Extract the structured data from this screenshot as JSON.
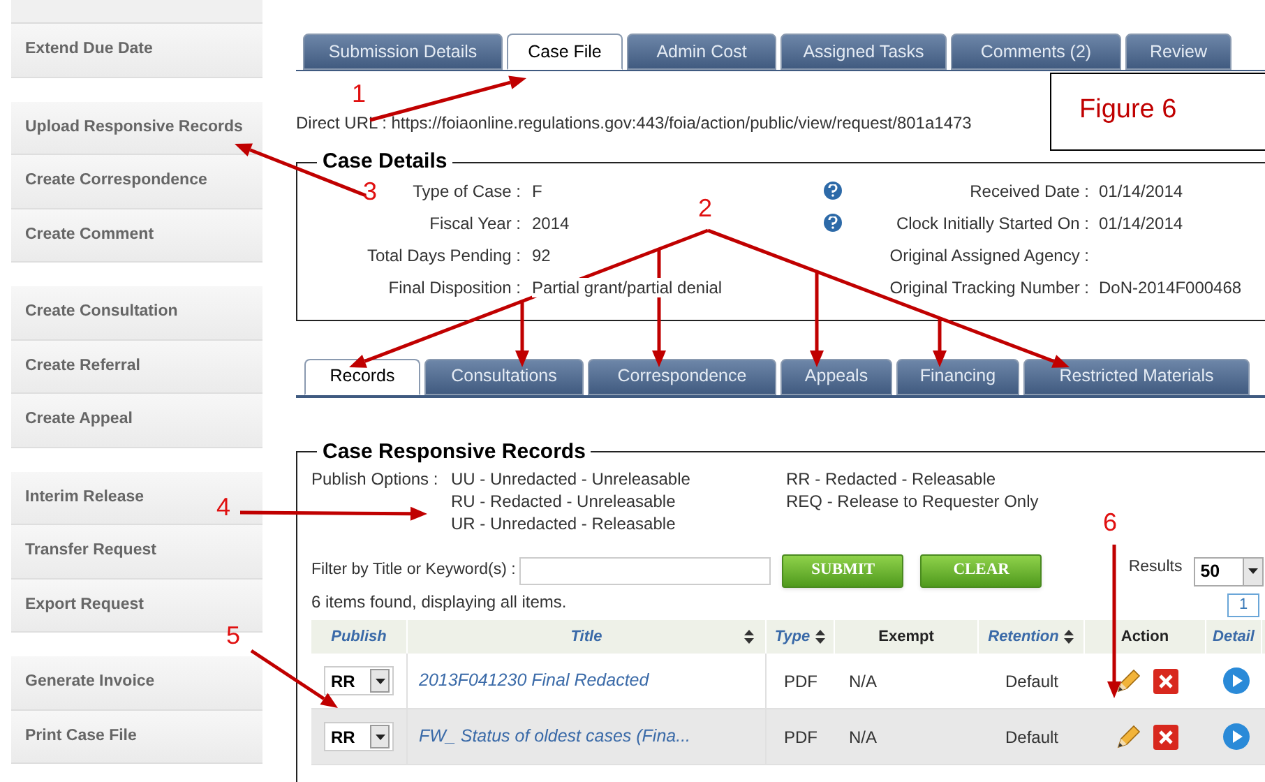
{
  "sidebar": {
    "groups": [
      [
        {
          "label": "Extend Due Date"
        }
      ],
      [
        {
          "label": "Upload Responsive Records"
        },
        {
          "label": "Create Correspondence"
        },
        {
          "label": "Create Comment"
        }
      ],
      [
        {
          "label": "Create Consultation"
        },
        {
          "label": "Create Referral"
        },
        {
          "label": "Create Appeal"
        }
      ],
      [
        {
          "label": "Interim Release"
        },
        {
          "label": "Transfer Request"
        },
        {
          "label": "Export Request"
        }
      ],
      [
        {
          "label": "Generate Invoice"
        },
        {
          "label": "Print Case File"
        }
      ]
    ]
  },
  "tabs": [
    {
      "label": "Submission Details",
      "selected": false
    },
    {
      "label": "Case File",
      "selected": true
    },
    {
      "label": "Admin Cost",
      "selected": false
    },
    {
      "label": "Assigned Tasks",
      "selected": false
    },
    {
      "label": "Comments (2)",
      "selected": false
    },
    {
      "label": "Review",
      "selected": false
    }
  ],
  "direct_url": "Direct URL : https://foiaonline.regulations.gov:443/foia/action/public/view/request/801a1473",
  "case_details": {
    "title": "Case Details",
    "left": [
      {
        "label": "Type of Case :",
        "value": "F"
      },
      {
        "label": "Fiscal Year :",
        "value": "2014"
      },
      {
        "label": "Total Days Pending :",
        "value": "92"
      },
      {
        "label": "Final Disposition :",
        "value": "Partial grant/partial denial"
      }
    ],
    "right": [
      {
        "label": "Received Date :",
        "value": "01/14/2014",
        "help": true
      },
      {
        "label": "Clock Initially Started On :",
        "value": "01/14/2014",
        "help": true
      },
      {
        "label": "Original Assigned Agency :",
        "help": false
      },
      {
        "label": "Original Tracking Number :",
        "value": "DoN-2014F000468",
        "help": false
      }
    ]
  },
  "subtabs": [
    {
      "label": "Records",
      "selected": true
    },
    {
      "label": "Consultations",
      "selected": false
    },
    {
      "label": "Correspondence",
      "selected": false
    },
    {
      "label": "Appeals",
      "selected": false
    },
    {
      "label": "Financing",
      "selected": false
    },
    {
      "label": "Restricted Materials",
      "selected": false
    }
  ],
  "records": {
    "title": "Case Responsive Records",
    "publish_label": "Publish Options :",
    "publish_columns": [
      [
        "UU - Unredacted - Unreleasable",
        "RU - Redacted - Unreleasable",
        "UR - Unredacted - Releasable"
      ],
      [
        "RR - Redacted - Releasable",
        "REQ - Release to Requester Only"
      ]
    ],
    "filter_label": "Filter by Title or Keyword(s) :",
    "buttons": [
      "SUBMIT",
      "CLEAR"
    ],
    "results_label": "Results",
    "results_value": "50",
    "status": "6 items found, displaying all items.",
    "page": "1",
    "columns": [
      {
        "label": "Publish",
        "link": true,
        "sortable": false
      },
      {
        "label": "Title",
        "link": true,
        "sortable": true
      },
      {
        "label": "Type",
        "link": true,
        "sortable": true
      },
      {
        "label": "Exempt",
        "link": false,
        "sortable": false
      },
      {
        "label": "Retention",
        "link": true,
        "sortable": true
      },
      {
        "label": "Action",
        "link": false,
        "sortable": false
      },
      {
        "label": "Detail",
        "link": true,
        "sortable": false
      }
    ],
    "rows": [
      {
        "publish": "RR",
        "title": "2013F041230 Final Redacted",
        "type": "PDF",
        "exempt": "N/A",
        "retention": "Default"
      },
      {
        "publish": "RR",
        "title": "FW_ Status of oldest cases (Fina...",
        "type": "PDF",
        "exempt": "N/A",
        "retention": "Default"
      }
    ]
  },
  "annotations": {
    "figure_label": "Figure 6",
    "callouts": [
      "1",
      "2",
      "3",
      "4",
      "5",
      "6"
    ]
  }
}
